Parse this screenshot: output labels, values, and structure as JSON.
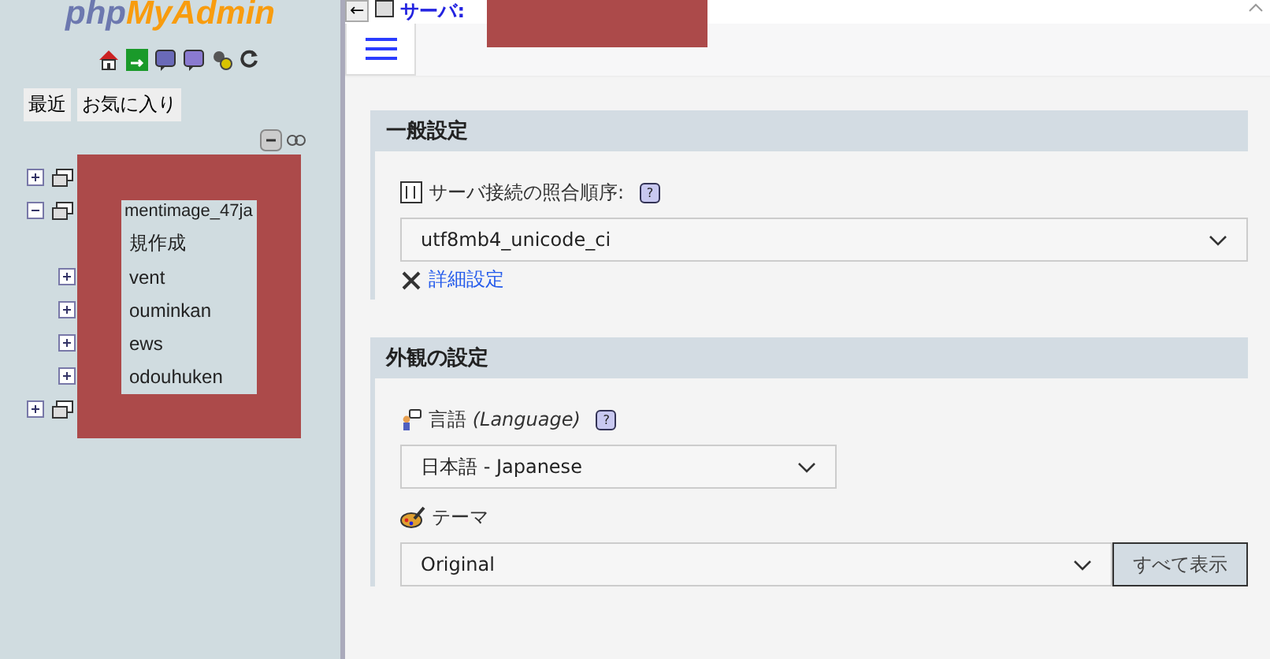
{
  "logo": {
    "part_1": "php",
    "part_2": "MyAdmin"
  },
  "nav_tabs": [
    {
      "label": "最近"
    },
    {
      "label": "お気に入り"
    }
  ],
  "tree": [
    {
      "expanded": false
    },
    {
      "expanded": true,
      "label": "mentimage_47ja",
      "children": [
        {
          "kind": "new",
          "label": "規作成"
        },
        {
          "kind": "db",
          "expanded": false,
          "label": "vent"
        },
        {
          "kind": "db",
          "expanded": false,
          "label": "ouminkan"
        },
        {
          "kind": "db",
          "expanded": false,
          "label": "ews"
        },
        {
          "kind": "db",
          "expanded": false,
          "label": "odouhuken"
        }
      ]
    },
    {
      "expanded": false
    }
  ],
  "top_bar": {
    "back": "←",
    "server_label": "サーバ:"
  },
  "sections": [
    {
      "title": "一般設定",
      "link": "詳細設定",
      "fields": [
        {
          "kind": "collation",
          "label": "サーバ接続の照合順序:",
          "help": "?",
          "value": "utf8mb4_unicode_ci"
        }
      ]
    },
    {
      "title": "外観の設定",
      "fields": [
        {
          "kind": "language",
          "label": "言語 *(Language)*",
          "help": "?",
          "value": "日本語 - Japanese"
        },
        {
          "kind": "theme",
          "label": "テーマ",
          "value": "Original",
          "button": "すべて表示"
        }
      ]
    }
  ]
}
